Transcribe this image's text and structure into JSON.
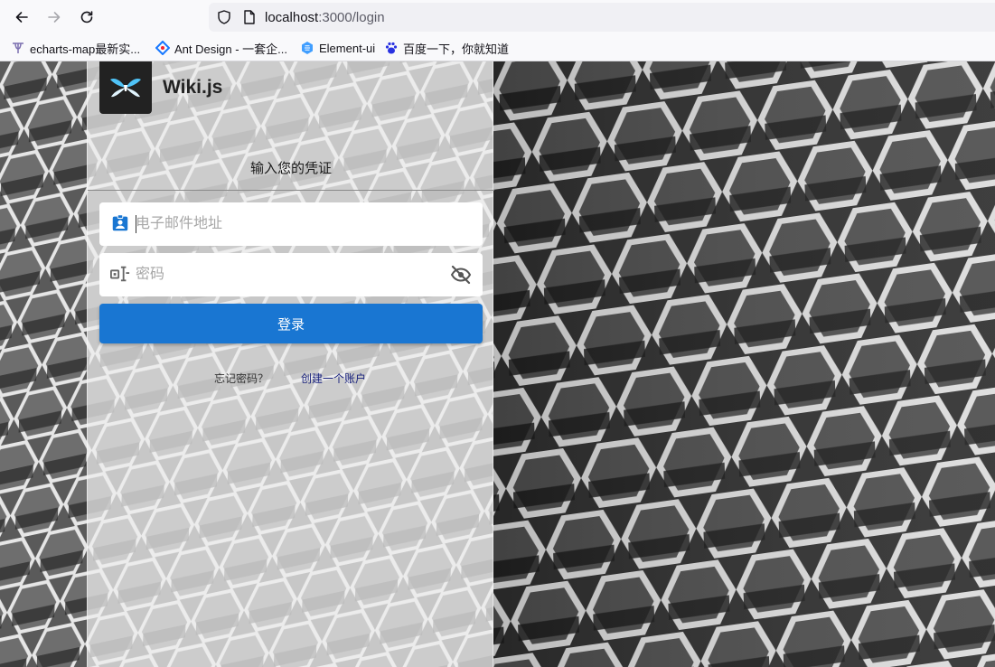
{
  "browser": {
    "url_host": "localhost",
    "url_path": ":3000/login",
    "icons": {
      "back": "arrow-left-icon",
      "forward": "arrow-right-icon",
      "reload": "reload-icon",
      "tracking": "shield-icon",
      "page_info": "page-icon"
    },
    "bookmarks": [
      {
        "label": "echarts-map最新实...",
        "icon": "echarts-icon"
      },
      {
        "label": "Ant Design - 一套企...",
        "icon": "ant-design-icon"
      },
      {
        "label": "Element-ui",
        "icon": "element-ui-icon"
      },
      {
        "label": "百度一下，你就知道",
        "icon": "baidu-icon"
      }
    ]
  },
  "login": {
    "brand": "Wiki.js",
    "title": "输入您的凭证",
    "email": {
      "value": "",
      "placeholder": "电子邮件地址",
      "icon": "contact-badge-icon"
    },
    "password": {
      "value": "",
      "placeholder": "密码",
      "icon": "password-cursor-icon",
      "toggle_icon": "eye-off-icon"
    },
    "submit_label": "登录",
    "forgot_label": "忘记密码？",
    "create_label": "创建一个账户"
  },
  "colors": {
    "primary": "#1976d2",
    "link": "#1a237e",
    "icon_blue": "#1976d2",
    "icon_gray": "#666666"
  }
}
